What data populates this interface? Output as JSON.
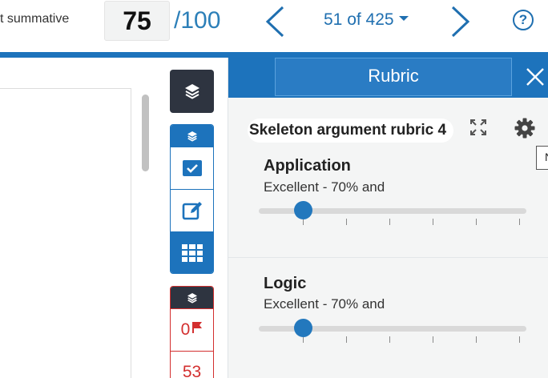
{
  "header": {
    "assignment_title": "t summative",
    "score": "75",
    "score_max": "/100",
    "counter": "51 of 425"
  },
  "sidebar": {
    "flags_count": "0",
    "second_count": "53"
  },
  "rubric": {
    "panel_title": "Rubric",
    "name": "Skeleton argument rubric 4",
    "tooltip_fragment": "N",
    "criteria": [
      {
        "title": "Application",
        "level": "Excellent - 70% and",
        "slider_value_fraction": 0.13
      },
      {
        "title": "Logic",
        "level": "Excellent - 70% and",
        "slider_value_fraction": 0.13
      }
    ]
  },
  "colors": {
    "brand_blue": "#1d73bc",
    "dark_tool": "#2e3440",
    "flag_red": "#d32f2f"
  },
  "icons": [
    "chevron-left-icon",
    "chevron-right-icon",
    "help-icon",
    "layers-icon",
    "checkbox-icon",
    "edit-icon",
    "grid-icon",
    "flag-icon",
    "close-icon",
    "expand-icon",
    "gear-icon"
  ]
}
